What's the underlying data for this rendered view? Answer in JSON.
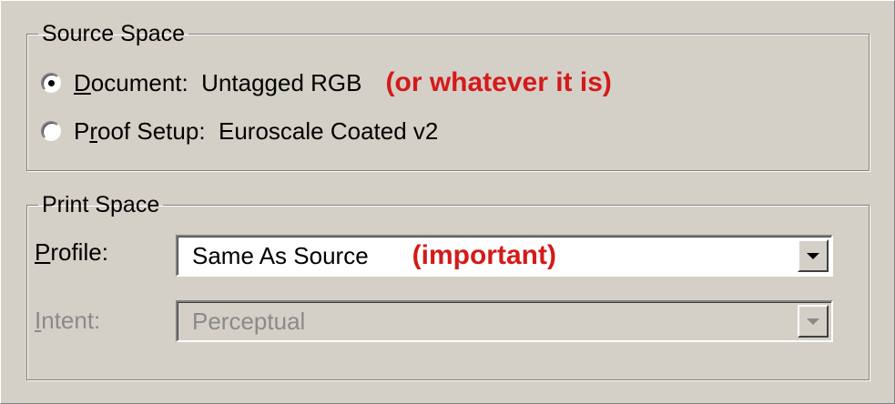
{
  "source_space": {
    "title": "Source Space",
    "options": [
      {
        "prefix": "",
        "mnemonic": "D",
        "rest": "ocument:  Untagged RGB",
        "selected": true
      },
      {
        "prefix": "P",
        "mnemonic": "r",
        "rest": "oof Setup:  Euroscale Coated v2",
        "selected": false
      }
    ],
    "annotation": "(or whatever it is)"
  },
  "print_space": {
    "title": "Print Space",
    "profile": {
      "label_mnemonic": "P",
      "label_rest": "rofile:",
      "value": "Same As Source",
      "annotation": "(important)"
    },
    "intent": {
      "label_mnemonic": "I",
      "label_rest": "ntent:",
      "value": "Perceptual",
      "disabled": true
    }
  },
  "colors": {
    "annotation": "#d41a1a",
    "background": "#d4d0c8",
    "disabled_text": "#8a8a8a"
  },
  "icons": {
    "dropdown": "chevron-down-icon",
    "radio": "radio-button"
  }
}
